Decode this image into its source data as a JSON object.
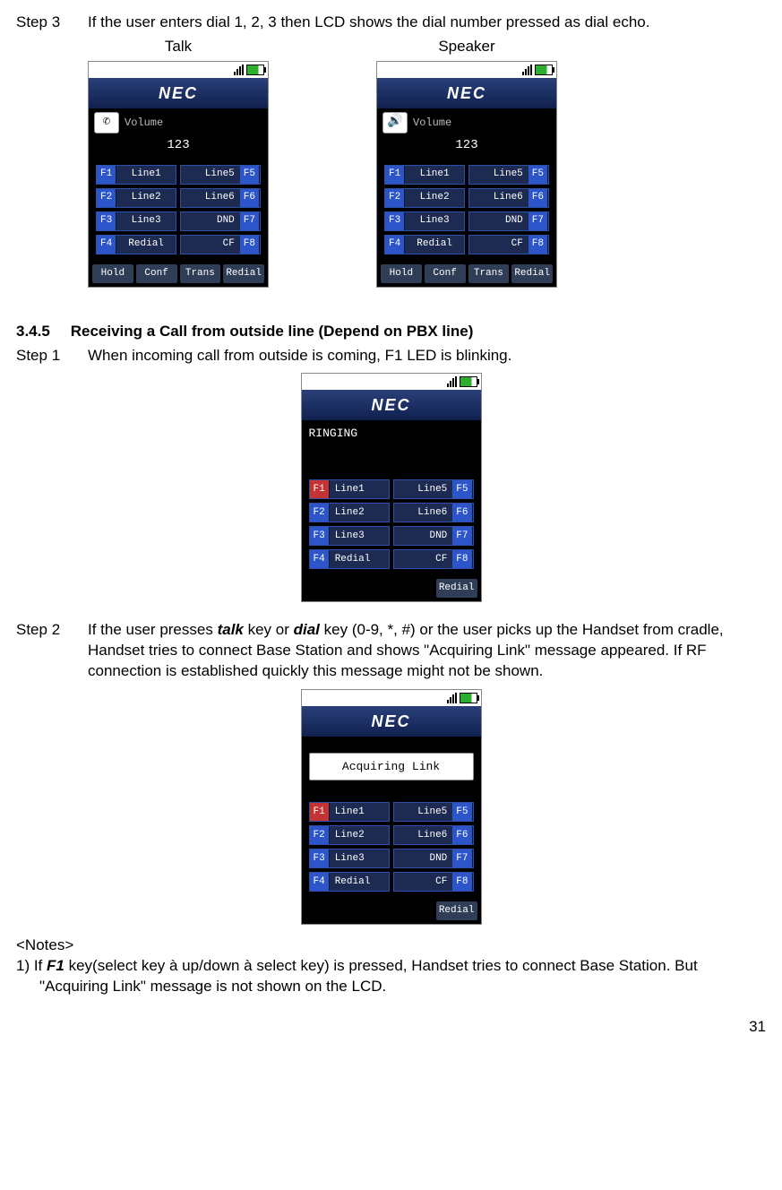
{
  "step3": {
    "label": "Step 3",
    "text": "If the user enters dial 1, 2, 3 then LCD shows the dial number pressed as dial echo.",
    "col1_title": "Talk",
    "col2_title": "Speaker"
  },
  "brand": "NEC",
  "volume_label": "Volume",
  "dial_echo": "123",
  "icons": {
    "talk": "✆",
    "speaker": "🔊"
  },
  "fnkeys_left": [
    {
      "tag": "F1",
      "lbl": "Line1"
    },
    {
      "tag": "F2",
      "lbl": "Line2"
    },
    {
      "tag": "F3",
      "lbl": "Line3"
    },
    {
      "tag": "F4",
      "lbl": "Redial"
    }
  ],
  "fnkeys_right": [
    {
      "tag": "F5",
      "lbl": "Line5"
    },
    {
      "tag": "F6",
      "lbl": "Line6"
    },
    {
      "tag": "F7",
      "lbl": "DND"
    },
    {
      "tag": "F8",
      "lbl": "CF"
    }
  ],
  "softkeys_full": [
    "Hold",
    "Conf",
    "Trans",
    "Redial"
  ],
  "softkey_redial_only": "Redial",
  "section": {
    "num": "3.4.5",
    "title": "Receiving a Call from outside line (Depend on PBX line)"
  },
  "s1": {
    "label": "Step 1",
    "text": "When incoming call from outside is coming, F1 LED is blinking.",
    "status": "RINGING"
  },
  "s2": {
    "label": "Step 2",
    "text_a": "If the user presses ",
    "kw1": "talk",
    "text_b": " key or ",
    "kw2": "dial",
    "text_c": " key (0-9, *, #) or the user picks up the Handset from cradle, Handset tries to connect Base Station and shows \"Acquiring Link\" message appeared. If RF connection is established quickly this message might not be shown.",
    "msg": "Acquiring Link"
  },
  "notes": {
    "heading": "<Notes>",
    "item1_a": "1)   If ",
    "item1_kw": "F1",
    "item1_b": " key(select key à  up/down à select key) is pressed, Handset tries to connect Base Station. But \"Acquiring Link\" message is not shown on the LCD."
  },
  "page_number": "31"
}
